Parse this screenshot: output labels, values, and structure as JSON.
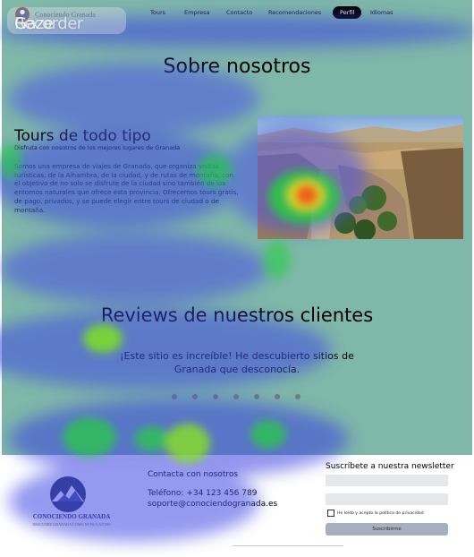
{
  "watermark": {
    "part1": "Gaze",
    "part2": "Recorder"
  },
  "nav": {
    "brand": "Conociendo Granada",
    "items": [
      "Tours",
      "Empresa",
      "Contacto",
      "Recomendaciones"
    ],
    "active": "Perfil",
    "languages": "Idiomas"
  },
  "about": {
    "title": "Sobre nosotros"
  },
  "tours": {
    "title": "Tours de todo tipo",
    "subtitle": "Disfruta con nosotros de los mejores lugares de Granada",
    "description": "Somos una empresa de viajes de Granada, que organiza visitas turísticas; de la Alhambra, de la ciudad, y de rutas de montaña, con el objetivo de no solo se disfrute de la ciudad sino también de los entornos naturales que ofrece esta provincia. Ofrecemos tours gratis, de pago, privados, y se puede elegir entre tours de ciudad o de montaña.",
    "image_icon": "landscape-photo"
  },
  "reviews": {
    "title": "Reviews de nuestros clientes",
    "quote": "¡Este sitio es increíble! He descubierto sitios de Granada que desconocía.",
    "slides": 7
  },
  "footer": {
    "logo_name": "CONOCIENDO GRANADA",
    "logo_tagline": "DESCUBRE GRANADA COMO NUNCA ANTES",
    "contact_title": "Contacta con nosotros",
    "phone": "Teléfono: +34 123 456 789",
    "email": "soporte@conociendogranada.es",
    "newsletter_title": "Suscríbete a nuestra newsletter",
    "input1_value": "",
    "input2_value": "",
    "privacy_label": "He leído y acepto la política de privacidad",
    "subscribe_label": "Suscribirme"
  },
  "colors": {
    "teal": "#7fb7a9",
    "navy": "#2b355e",
    "button": "#a7aebd"
  }
}
